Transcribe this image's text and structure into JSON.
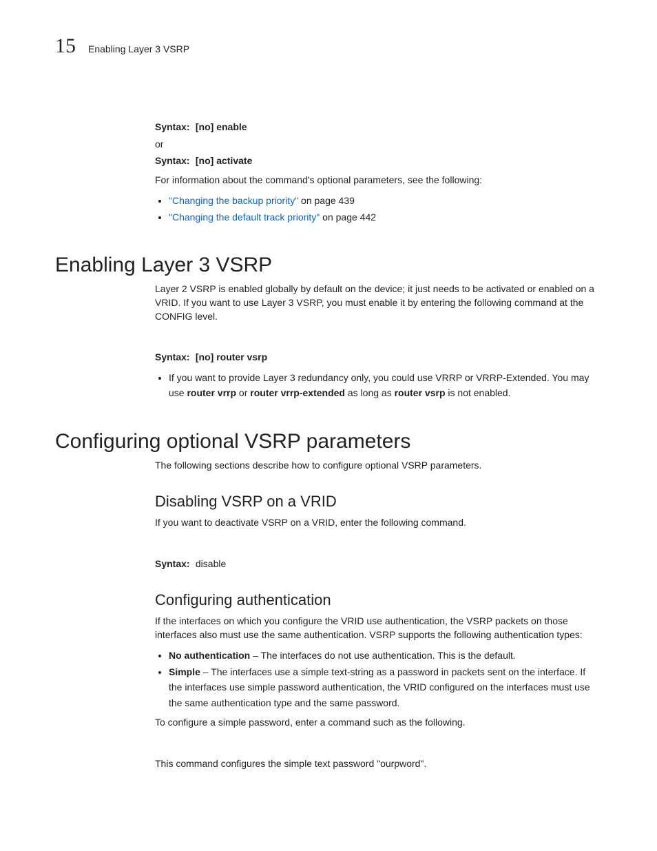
{
  "header": {
    "chapnum": "15",
    "title": "Enabling Layer 3 VSRP"
  },
  "pre": {
    "syntax_label": "Syntax:",
    "syntax1": "[no] enable",
    "or": "or",
    "syntax2": "[no] activate",
    "intro": "For information about the command's optional parameters, see the following:",
    "link1_text": "\"Changing the backup priority\"",
    "link1_suffix": " on page 439",
    "link2_text": "\"Changing the default track priority\"",
    "link2_suffix": " on page 442"
  },
  "sec1": {
    "heading": "Enabling Layer 3 VSRP",
    "p1": "Layer 2 VSRP is enabled globally by default on the device; it just needs to be activated or enabled on a VRID. If you want to use Layer 3 VSRP, you must enable it by entering the following command at the CONFIG level.",
    "syntax_label": "Syntax:",
    "syntax": "[no] router vsrp",
    "bullet_pre": "If you want to provide Layer 3 redundancy only, you could use VRRP or VRRP-Extended. You may use ",
    "b1": "router vrrp",
    "mid1": " or ",
    "b2": "router vrrp-extended",
    "mid2": " as long as ",
    "b3": "router vsrp",
    "tail": " is not enabled."
  },
  "sec2": {
    "heading": "Configuring optional VSRP parameters",
    "p1": "The following sections describe how to configure optional VSRP parameters.",
    "sub1": {
      "heading": "Disabling VSRP on a VRID",
      "p1": "If you want to deactivate VSRP on a VRID, enter the following command.",
      "syntax_label": "Syntax:",
      "syntax": "disable"
    },
    "sub2": {
      "heading": "Configuring authentication",
      "p1": "If the interfaces on which you configure the VRID use authentication, the VSRP packets on those interfaces also must use the same authentication. VSRP supports the following authentication types:",
      "bullet1_b": "No authentication",
      "bullet1_t": " – The interfaces do not use authentication. This is the default.",
      "bullet2_b": "Simple",
      "bullet2_t": " – The interfaces use a simple text-string as a password in packets sent on the interface.  If the interfaces use simple password authentication, the VRID configured on the interfaces must use the same authentication type and the same password.",
      "p2": "To configure a simple password, enter a command such as the following.",
      "p3": "This command configures the simple text password \"ourpword\"."
    }
  }
}
